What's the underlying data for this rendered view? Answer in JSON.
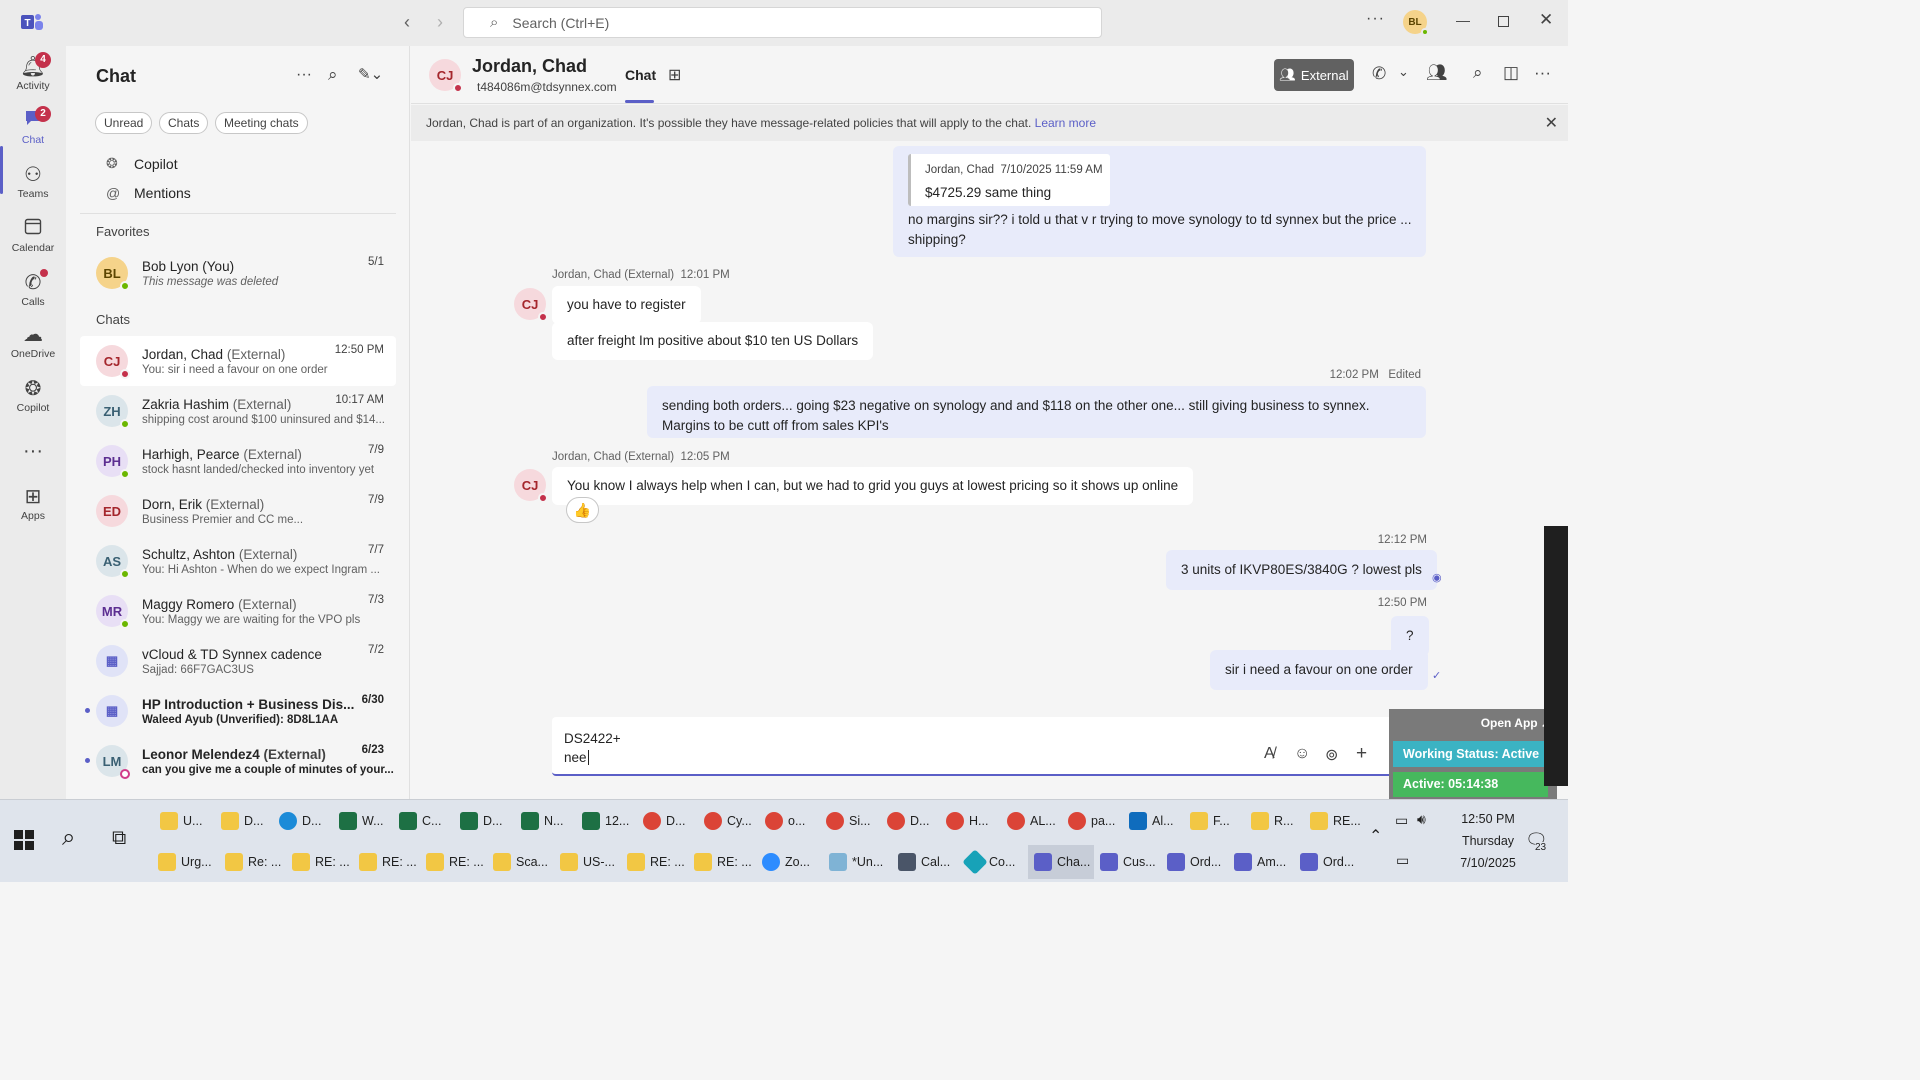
{
  "title_bar": {
    "search_placeholder": "Search (Ctrl+E)",
    "user_initials": "BL"
  },
  "rail": {
    "items": [
      {
        "label": "Activity",
        "badge": "4"
      },
      {
        "label": "Chat",
        "badge": "2"
      },
      {
        "label": "Teams"
      },
      {
        "label": "Calendar"
      },
      {
        "label": "Calls"
      },
      {
        "label": "OneDrive"
      },
      {
        "label": "Copilot"
      },
      {
        "label": "Apps"
      }
    ]
  },
  "chat_list": {
    "title": "Chat",
    "filters": [
      "Unread",
      "Chats",
      "Meeting chats"
    ],
    "nav": [
      "Copilot",
      "Mentions"
    ],
    "favorites_label": "Favorites",
    "chats_label": "Chats",
    "favorites": [
      {
        "initials": "BL",
        "name": "Bob Lyon (You)",
        "ext": "",
        "preview": "This message was deleted",
        "time": "5/1"
      }
    ],
    "chats": [
      {
        "initials": "CJ",
        "name": "Jordan, Chad",
        "ext": "(External)",
        "preview": "You: sir i need a favour on one order",
        "time": "12:50 PM"
      },
      {
        "initials": "ZH",
        "name": "Zakria Hashim",
        "ext": "(External)",
        "preview": "shipping cost around $100 uninsured and $14...",
        "time": "10:17 AM"
      },
      {
        "initials": "PH",
        "name": "Harhigh, Pearce",
        "ext": "(External)",
        "preview": "stock hasnt landed/checked into inventory yet",
        "time": "7/9"
      },
      {
        "initials": "ED",
        "name": "Dorn, Erik",
        "ext": "(External)",
        "preview": "Business Premier and CC me...",
        "time": "7/9"
      },
      {
        "initials": "AS",
        "name": "Schultz, Ashton",
        "ext": "(External)",
        "preview": "You: Hi Ashton -  When do we expect Ingram ...",
        "time": "7/7"
      },
      {
        "initials": "MR",
        "name": "Maggy Romero",
        "ext": "(External)",
        "preview": "You: Maggy we are waiting for the VPO pls",
        "time": "7/3"
      },
      {
        "initials": "",
        "name": "vCloud & TD Synnex cadence",
        "ext": "",
        "preview": "Sajjad: 66F7GAC3US",
        "time": "7/2"
      },
      {
        "initials": "",
        "name": "HP Introduction + Business Dis...",
        "ext": "",
        "preview": "Waleed Ayub (Unverified): 8D8L1AA",
        "time": "6/30"
      },
      {
        "initials": "LM",
        "name": "Leonor Melendez4",
        "ext": "(External)",
        "preview": "can you give me a couple of minutes of your...",
        "time": "6/23"
      }
    ]
  },
  "conversation": {
    "header": {
      "initials": "CJ",
      "name": "Jordan, Chad",
      "email": "t484086m@tdsynnex.com",
      "tab_chat": "Chat",
      "external_label": "External"
    },
    "banner": {
      "text": "Jordan, Chad is part of an organization. It's possible they have message-related policies that will apply to the chat.",
      "link": "Learn more"
    },
    "quote": {
      "author": "Jordan, Chad",
      "time": "7/10/2025 11:59 AM",
      "text": "$4725.29 same thing"
    },
    "msg_out_1": "no margins sir?? i told u that v r trying to move synology to td synnex but the price ...\nshipping?",
    "group_in_1": {
      "sender": "Jordan, Chad (External)",
      "time": "12:01 PM",
      "initials": "CJ"
    },
    "msg_in_1": "you have to register",
    "msg_in_2": "after freight Im positive about $10 ten US Dollars",
    "out_time_2": "12:02 PM",
    "out_edited": "Edited",
    "msg_out_2a": "sending both orders... going $23 negative on synology and and $118 on the other one... still giving business to synnex.",
    "msg_out_2b": "Margins to be cutt off from sales KPI's",
    "group_in_2": {
      "sender": "Jordan, Chad (External)",
      "time": "12:05 PM",
      "initials": "CJ"
    },
    "msg_in_3": "You know I always help when I can, but we had to grid you guys at lowest pricing so it shows up online",
    "reaction": "👍",
    "out_time_3": "12:12 PM",
    "msg_out_3": "3 units of IKVP80ES/3840G ? lowest pls",
    "out_time_4": "12:50 PM",
    "msg_out_4": "?",
    "msg_out_5": "sir i need a favour on one order",
    "compose_line1": "DS2422+",
    "compose_line2": "nee"
  },
  "overlay": {
    "open_app": "Open App ↗",
    "working_status": "Working Status: Active",
    "active_timer": "Active: 05:14:38"
  },
  "taskbar": {
    "row1": [
      "U...",
      "D...",
      "D...",
      "W...",
      "C...",
      "D...",
      "N...",
      "12...",
      "D...",
      "Cy...",
      "o...",
      "Si...",
      "D...",
      "H...",
      "AL...",
      "pa...",
      "Al...",
      "F...",
      "R...",
      "RE..."
    ],
    "row2": [
      "Urg...",
      "Re: ...",
      "RE: ...",
      "RE: ...",
      "RE: ...",
      "Sca...",
      "US-...",
      "RE: ...",
      "RE: ...",
      "Zo...",
      "*Un...",
      "Cal...",
      "Co...",
      "Cha...",
      "Cus...",
      "Ord...",
      "Am...",
      "Ord..."
    ],
    "clock_time": "12:50 PM",
    "clock_day": "Thursday",
    "clock_date": "7/10/2025",
    "notif_count": "23"
  }
}
